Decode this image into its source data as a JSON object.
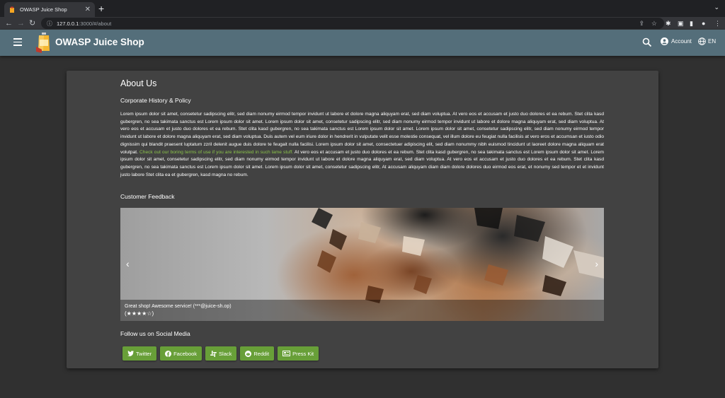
{
  "browser": {
    "tab_title": "OWASP Juice Shop",
    "url_host": "127.0.0.1",
    "url_path": ":3000/#/about"
  },
  "appbar": {
    "brand": "OWASP Juice Shop",
    "account_label": "Account",
    "language_label": "EN",
    "color": "#546e7a"
  },
  "about": {
    "title": "About Us",
    "history_heading": "Corporate History & Policy",
    "lorem_part1": "Lorem ipsum dolor sit amet, consetetur sadipscing elitr, sed diam nonumy eirmod tempor invidunt ut labore et dolore magna aliquyam erat, sed diam voluptua. At vero eos et accusam et justo duo dolores et ea rebum. Stet clita kasd gubergren, no sea takimata sanctus est Lorem ipsum dolor sit amet. Lorem ipsum dolor sit amet, consetetur sadipscing elitr, sed diam nonumy eirmod tempor invidunt ut labore et dolore magna aliquyam erat, sed diam voluptua. At vero eos et accusam et justo duo dolores et ea rebum. Stet clita kasd gubergren, no sea takimata sanctus est Lorem ipsum dolor sit amet. Lorem ipsum dolor sit amet, consetetur sadipscing elitr, sed diam nonumy eirmod tempor invidunt ut labore et dolore magna aliquyam erat, sed diam voluptua. Duis autem vel eum iriure dolor in hendrerit in vulputate velit esse molestie consequat, vel illum dolore eu feugiat nulla facilisis at vero eros et accumsan et iusto odio dignissim qui blandit praesent luptatum zzril delenit augue duis dolore te feugait nulla facilisi. Lorem ipsum dolor sit amet, consectetuer adipiscing elit, sed diam nonummy nibh euismod tincidunt ut laoreet dolore magna aliquam erat volutpat.",
    "terms_link": "Check out our boring terms of use if you are interested in such lame stuff.",
    "lorem_part2": "At vero eos et accusam et justo duo dolores et ea rebum. Stet clita kasd gubergren, no sea takimata sanctus est Lorem ipsum dolor sit amet. Lorem ipsum dolor sit amet, consetetur sadipscing elitr, sed diam nonumy eirmod tempor invidunt ut labore et dolore magna aliquyam erat, sed diam voluptua. At vero eos et accusam et justo duo dolores et ea rebum. Stet clita kasd gubergren, no sea takimata sanctus est Lorem ipsum dolor sit amet. Lorem ipsum dolor sit amet, consetetur sadipscing elitr, At accusam aliquyam diam diam dolore dolores duo eirmod eos erat, et nonumy sed tempor et et invidunt justo labore Stet clita ea et gubergren, kasd magna no rebum.",
    "link_color": "#8bc34a"
  },
  "feedback": {
    "heading": "Customer Feedback",
    "caption": "Great shop! Awesome service! (***@juice-sh.op)",
    "stars_text": "(★★★★☆)",
    "rating": 4,
    "prev_label": "‹",
    "next_label": "›"
  },
  "social": {
    "heading": "Follow us on Social Media",
    "buttons": [
      {
        "label": "Twitter",
        "icon": "twitter-icon"
      },
      {
        "label": "Facebook",
        "icon": "facebook-icon"
      },
      {
        "label": "Slack",
        "icon": "slack-icon"
      },
      {
        "label": "Reddit",
        "icon": "reddit-icon"
      },
      {
        "label": "Press Kit",
        "icon": "newspaper-icon"
      }
    ],
    "button_color": "#689f38"
  }
}
